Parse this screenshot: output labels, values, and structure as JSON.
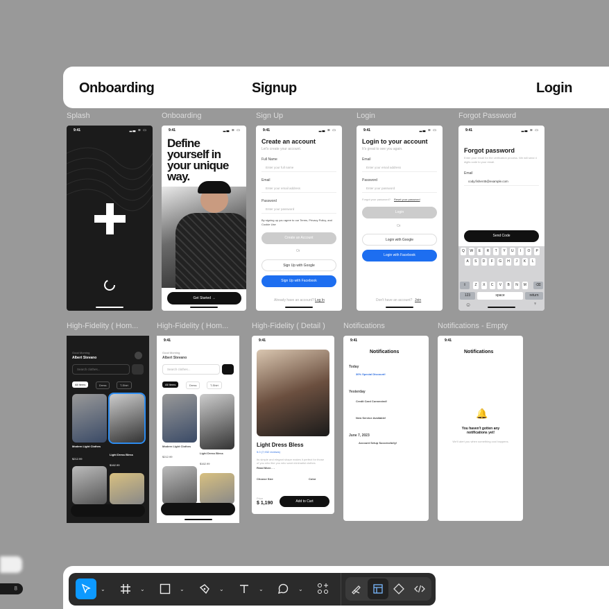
{
  "sections": {
    "onboarding": "Onboarding",
    "signup": "Signup",
    "login": "Login"
  },
  "frames": {
    "splash": "Splash",
    "onboarding": "Onboarding",
    "signup": "Sign Up",
    "login": "Login",
    "forgot": "Forgot Password",
    "hifi_home_dark": "High-Fidelity ( Hom...",
    "hifi_home_light": "High-Fidelity ( Hom...",
    "hifi_detail": "High-Fidelity ( Detail )",
    "notifications": "Notifications",
    "notifications_empty": "Notifications - Empty"
  },
  "status": {
    "time": "9:41",
    "icons": "▂▃ ≋ ▭"
  },
  "onboard": {
    "headline": "Define yourself in your unique way.",
    "cta": "Get Started →"
  },
  "signup": {
    "title": "Create an account",
    "subtitle": "Let's create your account.",
    "full_name": "Full Name",
    "full_name_ph": "Enter your full name",
    "email": "Email",
    "email_ph": "Enter your email address",
    "password": "Password",
    "password_ph": "Enter your password",
    "terms": "By signing up you agree to our Terms, Privacy Policy, and Cookie Use",
    "create": "Create an Account",
    "or": "Or",
    "google": "Sign Up with Google",
    "facebook": "Sign Up with Facebook",
    "have": "Already have an account?",
    "login_link": "Log In"
  },
  "login": {
    "title": "Login to your account",
    "subtitle": "It's great to see you again.",
    "email": "Email",
    "email_ph": "Enter your email address",
    "password": "Password",
    "password_ph": "Enter your password",
    "forgot": "Forgot your password?",
    "reset": "Reset your password",
    "login_btn": "Login",
    "or": "Or",
    "google": "Login with Google",
    "facebook": "Login with Facebook",
    "no_account": "Don't have an account?",
    "join": "Join"
  },
  "forgot": {
    "title": "Forgot password",
    "subtitle": "Enter your email for the verification process. We will send 4 digits code to your email.",
    "email": "Email",
    "email_val": "cody.fisher45@example.com",
    "send": "Send Code",
    "row1": [
      "Q",
      "W",
      "E",
      "R",
      "T",
      "Y",
      "U",
      "I",
      "O",
      "P"
    ],
    "row2": [
      "A",
      "S",
      "D",
      "F",
      "G",
      "H",
      "J",
      "K",
      "L"
    ],
    "row3": [
      "Z",
      "X",
      "C",
      "V",
      "B",
      "N",
      "M"
    ],
    "num": "123",
    "space": "space",
    "return": "return"
  },
  "home": {
    "greeting": "Good Morning",
    "name": "Albert Stevano",
    "search_ph": "Search clothes...",
    "chips": [
      "All Items",
      "Dress",
      "T-Shirt"
    ],
    "p1_name": "Modern Light Clothes",
    "p1_sub": "T-Shirt",
    "p1_price": "$212.99",
    "p1_rating": "5.0",
    "p2_name": "Light Dress Bless",
    "p2_sub": "Dress modern",
    "p2_price": "$162.99",
    "p2_rating": "5.0"
  },
  "detail": {
    "title": "Light Dress Bless",
    "rating": "5.0 (7,932 reviews)",
    "desc": "Its simple and elegant shape makes it perfect for those of you who like you who want minimalist clothes",
    "read_more": "Read More. . .",
    "size_label": "Choose Size",
    "sizes": [
      "S",
      "M",
      "L",
      "XL"
    ],
    "color_label": "Color",
    "price_label": "Price",
    "price": "$ 1,190",
    "add": "Add to Cart"
  },
  "notif": {
    "title": "Notifications",
    "today": "Today",
    "n1": "30% Special Discount!",
    "n1s": "Special promotion only valid today",
    "yesterday": "Yesterday",
    "n2": "Credit Card Connected!",
    "n2s": "Special promotion only valid today",
    "n3": "New Service Available!",
    "n3s": "Now you can track orders in real time",
    "date": "June 7, 2023",
    "n4": "Account Setup Successfully!",
    "n4s": "Your account has been created",
    "empty_title": "You haven't gotten any notifications yet!",
    "empty_sub": "We'll alert you when something cool happens."
  },
  "toolbar": {
    "badge": "8"
  }
}
